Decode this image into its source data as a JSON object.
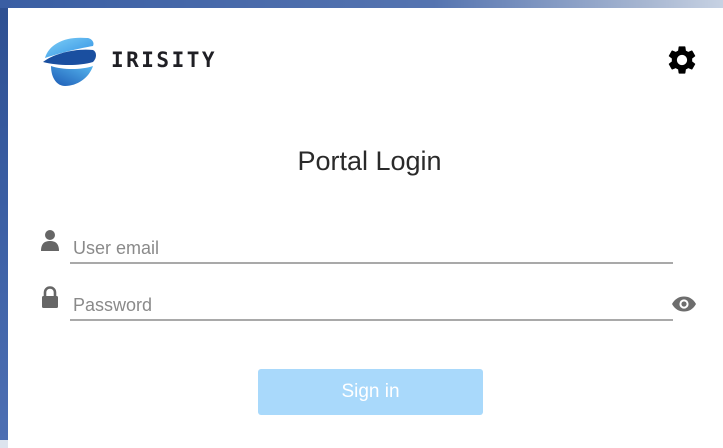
{
  "brand": {
    "name": "IRISITY",
    "logo_icon": "irisity-logo",
    "colors": [
      "#1a4fa0",
      "#2f8fe3",
      "#7fd0f7"
    ]
  },
  "header": {
    "settings_icon": "gear-icon"
  },
  "main": {
    "title": "Portal Login",
    "email": {
      "icon": "user-icon",
      "placeholder": "User email",
      "value": ""
    },
    "password": {
      "icon": "lock-icon",
      "placeholder": "Password",
      "value": "",
      "toggle_icon": "eye-icon"
    },
    "sign_in_label": "Sign in",
    "sign_in_color": "#a9d9fb"
  }
}
